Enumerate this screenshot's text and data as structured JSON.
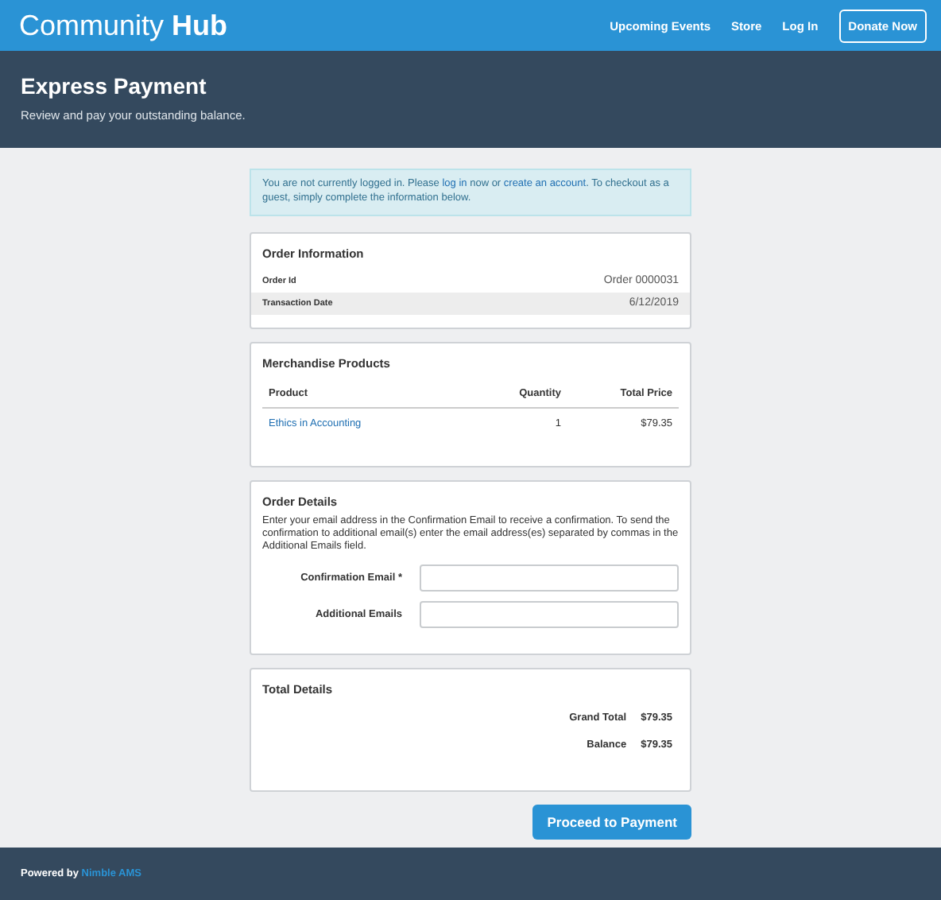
{
  "topbar": {
    "brand": {
      "light": "Community",
      "bold": "Hub"
    },
    "nav": [
      {
        "label": "Upcoming Events",
        "kind": "link"
      },
      {
        "label": "Store",
        "kind": "link"
      },
      {
        "label": "Log In",
        "kind": "link"
      },
      {
        "label": "Donate Now",
        "kind": "button"
      }
    ]
  },
  "header": {
    "title": "Express Payment",
    "subtitle": "Review and pay your outstanding balance."
  },
  "notice": [
    {
      "text": "You are not currently logged in. Please ",
      "kind": "text"
    },
    {
      "text": "log in",
      "kind": "link"
    },
    {
      "text": " now or ",
      "kind": "text"
    },
    {
      "text": "create an account",
      "kind": "link"
    },
    {
      "text": ". To checkout as a guest, simply complete the information below.",
      "kind": "text"
    }
  ],
  "order_information": {
    "title": "Order Information",
    "rows": [
      {
        "label": "Order Id",
        "value": "Order 0000031"
      },
      {
        "label": "Transaction Date",
        "value": "6/12/2019"
      }
    ]
  },
  "merchandise": {
    "title": "Merchandise Products",
    "columns": [
      "Product",
      "Quantity",
      "Total Price"
    ],
    "rows": [
      {
        "product": "Ethics in Accounting",
        "quantity": "1",
        "total": "$79.35"
      }
    ]
  },
  "order_details": {
    "title": "Order Details",
    "description": "Enter your email address in the Confirmation Email to receive a confirmation. To send the confirmation to additional email(s) enter the email address(es) separated by commas in the Additional Emails field.",
    "fields": [
      {
        "label": "Confirmation Email *"
      },
      {
        "label": "Additional Emails"
      }
    ]
  },
  "total_details": {
    "title": "Total Details",
    "rows": [
      {
        "label": "Grand Total",
        "value": "$79.35"
      },
      {
        "label": "Balance",
        "value": "$79.35"
      }
    ]
  },
  "submit": "Proceed to Payment",
  "footer": {
    "prefix": "Powered by ",
    "link": "Nimble AMS"
  }
}
